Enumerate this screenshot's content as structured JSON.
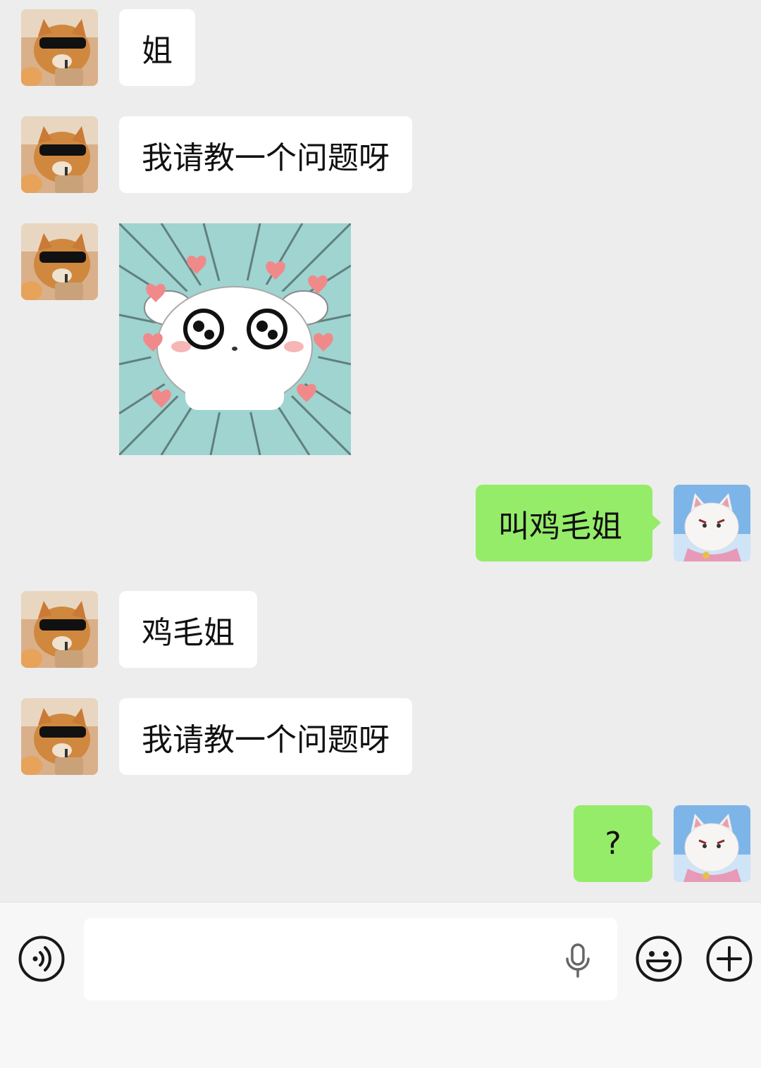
{
  "messages": [
    {
      "side": "in",
      "type": "text",
      "text": "姐"
    },
    {
      "side": "in",
      "type": "text",
      "text": "我请教一个问题呀"
    },
    {
      "side": "in",
      "type": "sticker",
      "sticker": "surprised-white-puppy-sticker"
    },
    {
      "side": "out",
      "type": "text",
      "text": "叫鸡毛姐"
    },
    {
      "side": "in",
      "type": "text",
      "text": "鸡毛姐"
    },
    {
      "side": "in",
      "type": "text",
      "text": "我请教一个问题呀"
    },
    {
      "side": "out",
      "type": "text",
      "text": "?"
    }
  ],
  "avatars": {
    "contact": "cat-sunglasses-avatar",
    "self": "cartoon-cat-avatar"
  },
  "input_bar": {
    "text_value": "",
    "voice_icon": "voice-toggle-icon",
    "mic_icon": "microphone-icon",
    "emoji_icon": "emoji-icon",
    "plus_icon": "plus-icon"
  },
  "colors": {
    "background": "#ededed",
    "incoming_bubble": "#ffffff",
    "outgoing_bubble": "#95ec69",
    "input_bar": "#f7f7f7"
  }
}
